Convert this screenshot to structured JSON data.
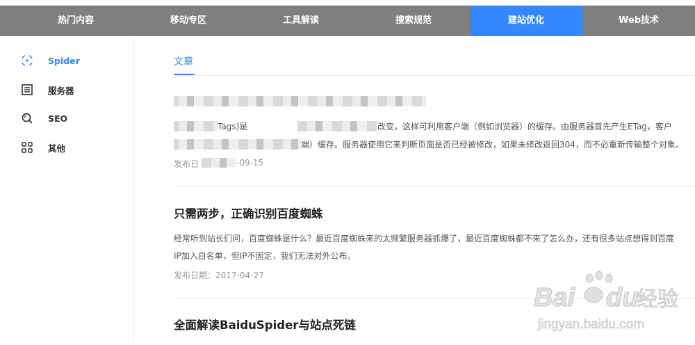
{
  "topnav": {
    "tabs": [
      {
        "label": "热门内容"
      },
      {
        "label": "移动专区"
      },
      {
        "label": "工具解读"
      },
      {
        "label": "搜索规范"
      },
      {
        "label": "建站优化"
      },
      {
        "label": "Web技术"
      }
    ]
  },
  "sidebar": {
    "items": [
      {
        "label": "Spider",
        "icon": "spider-icon"
      },
      {
        "label": "服务器",
        "icon": "server-icon"
      },
      {
        "label": "SEO",
        "icon": "seo-icon"
      },
      {
        "label": "其他",
        "icon": "grid-icon"
      }
    ]
  },
  "main": {
    "section_tab": "文章",
    "articles": [
      {
        "line1_fragment": "Tags)是",
        "line1_visible": "改变，这样可利用客户端（例如浏览器）的缓存。由服务器首先产生ETag，客户",
        "line2_fragment": "端）缓存。服务器使用它来判断页面是否已经被修改，如果未修改返回304，而不必重新传输整个对象。",
        "date_prefix": "发布日",
        "date_suffix": "-09-15"
      },
      {
        "title": "只需两步，正确识别百度蜘蛛",
        "line1": "经常听到站长们问，百度蜘蛛是什么？最近百度蜘蛛来的太频繁服务器抓爆了，最近百度蜘蛛都不来了怎么办，还有很多站点想得到百度",
        "line2": "IP加入白名单，但IP不固定，我们无法对外公布。",
        "date": "发布日期：2017-04-27"
      },
      {
        "title": "全面解读BaiduSpider与站点死链"
      }
    ]
  },
  "watermark": {
    "brand": "Baidu",
    "cn": "经验",
    "url": "jingyan.baidu.com"
  },
  "colors": {
    "accent": "#3388ff",
    "nav_bg": "#7f7f7f"
  }
}
